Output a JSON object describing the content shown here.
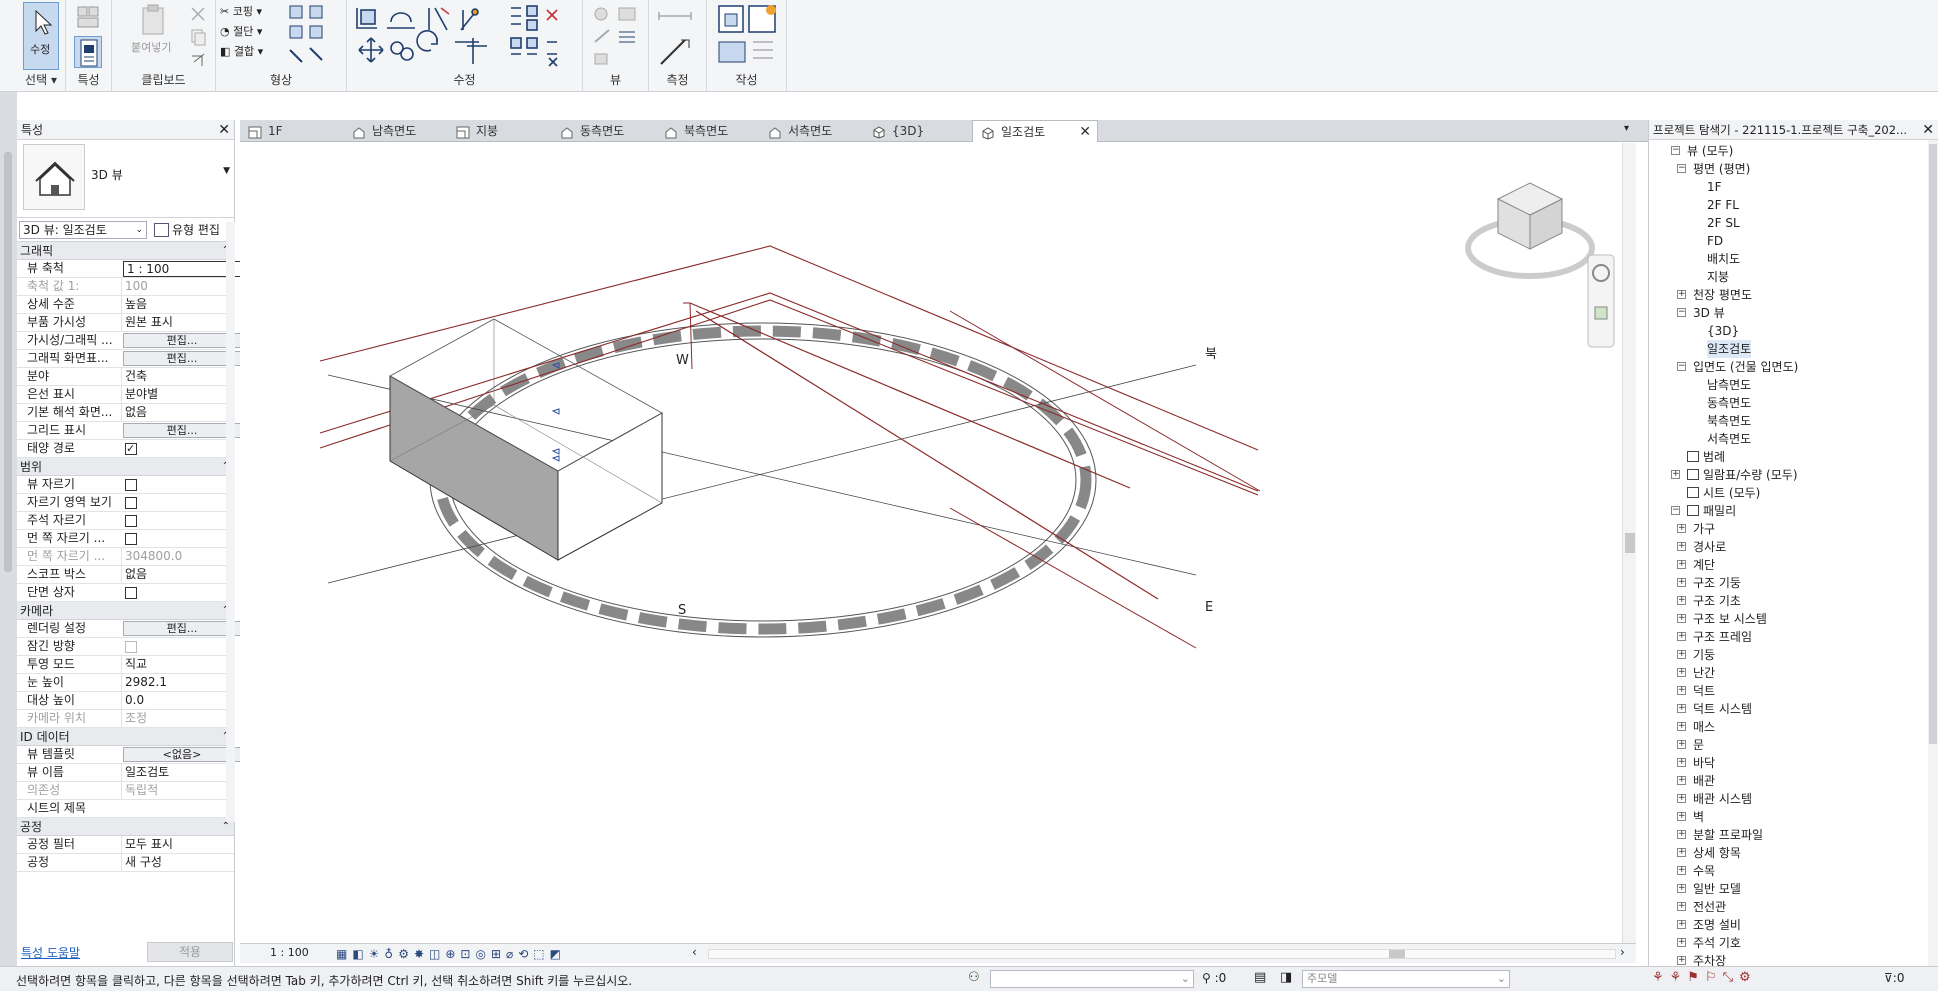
{
  "ribbon": {
    "groups": [
      {
        "label": "선택",
        "has_dropdown": true
      },
      {
        "label": "특성"
      },
      {
        "label": "클립보드"
      },
      {
        "label": "형상"
      },
      {
        "label": "수정"
      },
      {
        "label": "뷰"
      },
      {
        "label": "측정"
      },
      {
        "label": "작성"
      }
    ],
    "modify_label": "수정",
    "paste_label": "붙여넣기",
    "cope_label": "코핑",
    "cut_label": "절단",
    "join_label": "결합"
  },
  "properties": {
    "title": "특성",
    "type_name": "3D 뷰",
    "selector": "3D 뷰: 일조검토",
    "edit_type": "유형 편집",
    "sections": [
      {
        "title": "그래픽",
        "rows": [
          {
            "label": "뷰 축척",
            "value": "1 : 100",
            "kind": "input"
          },
          {
            "label": "축척 값    1:",
            "value": "100",
            "kind": "disabled"
          },
          {
            "label": "상세 수준",
            "value": "높음"
          },
          {
            "label": "부품 가시성",
            "value": "원본 표시"
          },
          {
            "label": "가시성/그래픽 ...",
            "value": "편집...",
            "kind": "button"
          },
          {
            "label": "그래픽 화면표...",
            "value": "편집...",
            "kind": "button"
          },
          {
            "label": "분야",
            "value": "건축"
          },
          {
            "label": "은선 표시",
            "value": "분야별"
          },
          {
            "label": "기본 해석 화면...",
            "value": "없음"
          },
          {
            "label": "그리드 표시",
            "value": "편집...",
            "kind": "button"
          },
          {
            "label": "태양 경로",
            "value": "",
            "kind": "check_on"
          }
        ]
      },
      {
        "title": "범위",
        "rows": [
          {
            "label": "뷰 자르기",
            "value": "",
            "kind": "check"
          },
          {
            "label": "자르기 영역 보기",
            "value": "",
            "kind": "check"
          },
          {
            "label": "주석 자르기",
            "value": "",
            "kind": "check"
          },
          {
            "label": "먼 쪽 자르기 ...",
            "value": "",
            "kind": "check"
          },
          {
            "label": "먼 쪽 자르기 ...",
            "value": "304800.0",
            "kind": "disabled"
          },
          {
            "label": "스코프 박스",
            "value": "없음"
          },
          {
            "label": "단면 상자",
            "value": "",
            "kind": "check"
          }
        ]
      },
      {
        "title": "카메라",
        "rows": [
          {
            "label": "렌더링 설정",
            "value": "편집...",
            "kind": "button"
          },
          {
            "label": "잠긴 방향",
            "value": "",
            "kind": "check_dis"
          },
          {
            "label": "투영 모드",
            "value": "직교"
          },
          {
            "label": "눈 높이",
            "value": "2982.1"
          },
          {
            "label": "대상 높이",
            "value": "0.0"
          },
          {
            "label": "카메라 위치",
            "value": "조정",
            "kind": "disabled"
          }
        ]
      },
      {
        "title": "ID 데이터",
        "rows": [
          {
            "label": "뷰 템플릿",
            "value": "<없음>",
            "kind": "button"
          },
          {
            "label": "뷰 이름",
            "value": "일조검토"
          },
          {
            "label": "의존성",
            "value": "독립적",
            "kind": "disabled"
          },
          {
            "label": "시트의 제목",
            "value": ""
          }
        ]
      },
      {
        "title": "공정",
        "rows": [
          {
            "label": "공정 필터",
            "value": "모두 표시"
          },
          {
            "label": "공정",
            "value": "새 구성"
          }
        ]
      }
    ],
    "help_link": "특성 도움말",
    "apply": "적용"
  },
  "view_tabs": [
    {
      "label": "1F",
      "icon": "plan-icon"
    },
    {
      "label": "남측면도",
      "icon": "elevation-icon"
    },
    {
      "label": "지붕",
      "icon": "plan-icon"
    },
    {
      "label": "동측면도",
      "icon": "elevation-icon"
    },
    {
      "label": "북측면도",
      "icon": "elevation-icon"
    },
    {
      "label": "서측면도",
      "icon": "elevation-icon"
    },
    {
      "label": "{3D}",
      "icon": "3d-view-icon"
    },
    {
      "label": "일조검토",
      "icon": "3d-view-icon",
      "active": true
    }
  ],
  "canvas": {
    "compass_labels": {
      "west": "W",
      "north": "북",
      "south": "S",
      "east": "E"
    },
    "view_scale": "1 : 100"
  },
  "browser": {
    "title": "프로젝트 탐색기 - 221115-1.프로젝트 구축_202...",
    "nodes": [
      {
        "label": "뷰 (모두)",
        "level": 0,
        "exp": "−"
      },
      {
        "label": "평면 (평면)",
        "level": 1,
        "exp": "−"
      },
      {
        "label": "1F",
        "level": 2
      },
      {
        "label": "2F FL",
        "level": 2
      },
      {
        "label": "2F SL",
        "level": 2
      },
      {
        "label": "FD",
        "level": 2
      },
      {
        "label": "배치도",
        "level": 2
      },
      {
        "label": "지붕",
        "level": 2
      },
      {
        "label": "천장 평면도",
        "level": 1,
        "exp": "+"
      },
      {
        "label": "3D 뷰",
        "level": 1,
        "exp": "−"
      },
      {
        "label": "{3D}",
        "level": 2
      },
      {
        "label": "일조검토",
        "level": 2,
        "selected": true
      },
      {
        "label": "입면도 (건물 입면도)",
        "level": 1,
        "exp": "−"
      },
      {
        "label": "남측면도",
        "level": 2
      },
      {
        "label": "동측면도",
        "level": 2
      },
      {
        "label": "북측면도",
        "level": 2
      },
      {
        "label": "서측면도",
        "level": 2
      },
      {
        "label": "범례",
        "level": 0,
        "icon": true
      },
      {
        "label": "일람표/수량 (모두)",
        "level": 0,
        "exp": "+",
        "icon": true
      },
      {
        "label": "시트 (모두)",
        "level": 0,
        "icon": true
      },
      {
        "label": "패밀리",
        "level": 0,
        "exp": "−",
        "icon": true
      },
      {
        "label": "가구",
        "level": 1,
        "exp": "+"
      },
      {
        "label": "경사로",
        "level": 1,
        "exp": "+"
      },
      {
        "label": "계단",
        "level": 1,
        "exp": "+"
      },
      {
        "label": "구조 기둥",
        "level": 1,
        "exp": "+"
      },
      {
        "label": "구조 기초",
        "level": 1,
        "exp": "+"
      },
      {
        "label": "구조 보 시스템",
        "level": 1,
        "exp": "+"
      },
      {
        "label": "구조 프레임",
        "level": 1,
        "exp": "+"
      },
      {
        "label": "기둥",
        "level": 1,
        "exp": "+"
      },
      {
        "label": "난간",
        "level": 1,
        "exp": "+"
      },
      {
        "label": "덕트",
        "level": 1,
        "exp": "+"
      },
      {
        "label": "덕트 시스템",
        "level": 1,
        "exp": "+"
      },
      {
        "label": "매스",
        "level": 1,
        "exp": "+"
      },
      {
        "label": "문",
        "level": 1,
        "exp": "+"
      },
      {
        "label": "바닥",
        "level": 1,
        "exp": "+"
      },
      {
        "label": "배관",
        "level": 1,
        "exp": "+"
      },
      {
        "label": "배관 시스템",
        "level": 1,
        "exp": "+"
      },
      {
        "label": "벽",
        "level": 1,
        "exp": "+"
      },
      {
        "label": "분할 프로파일",
        "level": 1,
        "exp": "+"
      },
      {
        "label": "상세 항목",
        "level": 1,
        "exp": "+"
      },
      {
        "label": "수목",
        "level": 1,
        "exp": "+"
      },
      {
        "label": "일반 모델",
        "level": 1,
        "exp": "+"
      },
      {
        "label": "전선관",
        "level": 1,
        "exp": "+"
      },
      {
        "label": "조명 설비",
        "level": 1,
        "exp": "+"
      },
      {
        "label": "주석 기호",
        "level": 1,
        "exp": "+"
      },
      {
        "label": "주차장",
        "level": 1,
        "exp": "+"
      }
    ]
  },
  "status": {
    "text": "선택하려면 항목을 클릭하고, 다른 항목을 선택하려면 Tab 키, 추가하려면 Ctrl 키, 선택 취소하려면 Shift 키를 누르십시오.",
    "count": ":0",
    "model": "주모델",
    "filter_count": ":0"
  }
}
